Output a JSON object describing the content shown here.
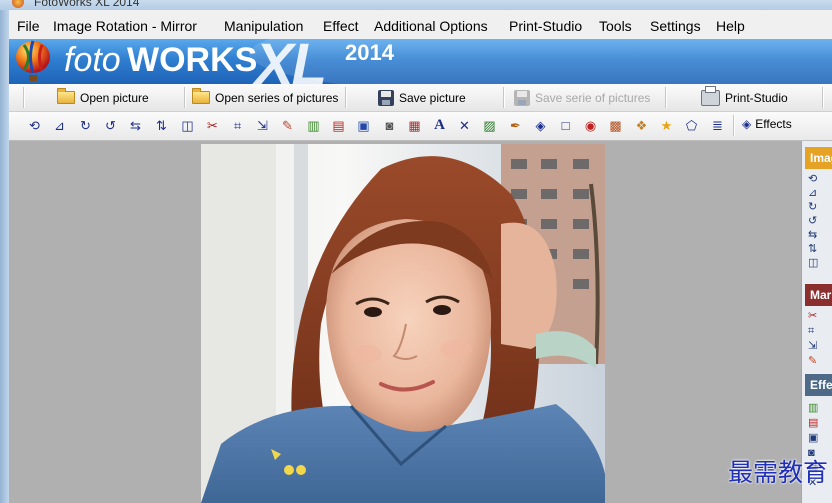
{
  "window": {
    "title": "FotoWorks XL 2014"
  },
  "menu": [
    "File",
    "Image Rotation - Mirror",
    "Manipulation",
    "Effect",
    "Additional Options",
    "Print-Studio",
    "Tools",
    "Settings",
    "Help"
  ],
  "banner": {
    "foto": "foto",
    "works": "WORKS",
    "xl": "XL",
    "year": "2014"
  },
  "toolbar": {
    "open_picture": "Open picture",
    "open_series": "Open series of pictures",
    "save_picture": "Save picture",
    "save_serie": "Save serie of pictures",
    "print_studio": "Print-Studio"
  },
  "tools": [
    "rotate-left",
    "rotate-right",
    "rotate-cw",
    "rotate-ccw",
    "flip-horizontal",
    "flip-vertical",
    "mirror",
    "cut",
    "crop",
    "resize",
    "brush",
    "levels",
    "color-balance",
    "frame",
    "camera",
    "picture",
    "text",
    "magic-wand",
    "landscape",
    "pen",
    "fill",
    "rectangle",
    "red-eye",
    "image-adjust",
    "gift",
    "star",
    "shape",
    "stack"
  ],
  "effects_label": "Effects",
  "right_panel": {
    "sections": [
      {
        "label": "Imag",
        "color": "#e5a224"
      },
      {
        "label": "Mar",
        "color": "#8a2e2e"
      },
      {
        "label": "Effe",
        "color": "#4e6a86"
      }
    ]
  },
  "watermark": "最需教育",
  "colors": {
    "banner": "#2f7fd1",
    "menubar": "#f0f0f0",
    "workspace": "#b0b0b0"
  }
}
